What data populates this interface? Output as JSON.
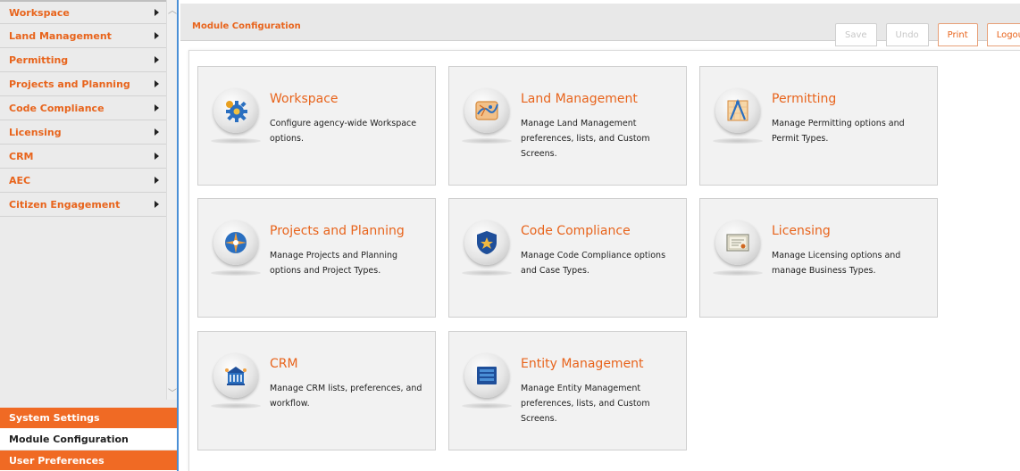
{
  "nav": {
    "items": [
      {
        "label": "Workspace"
      },
      {
        "label": "Land Management"
      },
      {
        "label": "Permitting"
      },
      {
        "label": "Projects and Planning"
      },
      {
        "label": "Code Compliance"
      },
      {
        "label": "Licensing"
      },
      {
        "label": "CRM"
      },
      {
        "label": "AEC"
      },
      {
        "label": "Citizen Engagement"
      }
    ],
    "bottom": [
      {
        "label": "System Settings"
      },
      {
        "label": "Module Configuration"
      },
      {
        "label": "User Preferences"
      }
    ]
  },
  "header": {
    "title": "Module Configuration"
  },
  "toolbar": {
    "save": "Save",
    "undo": "Undo",
    "print": "Print",
    "logout": "Logout"
  },
  "cards": [
    {
      "title": "Workspace",
      "description": "Configure agency-wide Workspace options.",
      "icon": "gear-icon"
    },
    {
      "title": "Land Management",
      "description": "Manage Land Management preferences, lists, and Custom Screens.",
      "icon": "map-icon"
    },
    {
      "title": "Permitting",
      "description": "Manage Permitting options and Permit Types.",
      "icon": "drafting-icon"
    },
    {
      "title": "Projects and Planning",
      "description": "Manage Projects and Planning options and Project Types.",
      "icon": "planning-icon"
    },
    {
      "title": "Code Compliance",
      "description": "Manage Code Compliance options and Case Types.",
      "icon": "badge-icon"
    },
    {
      "title": "Licensing",
      "description": "Manage Licensing options and manage Business Types.",
      "icon": "certificate-icon"
    },
    {
      "title": "CRM",
      "description": "Manage CRM lists, preferences, and workflow.",
      "icon": "building-icon"
    },
    {
      "title": "Entity Management",
      "description": "Manage Entity Management preferences, lists, and Custom Screens.",
      "icon": "folder-icon"
    }
  ],
  "colors": {
    "accent": "#e8641c",
    "active_bar": "#f06a24",
    "sidebar_border": "#4a8fd6"
  }
}
